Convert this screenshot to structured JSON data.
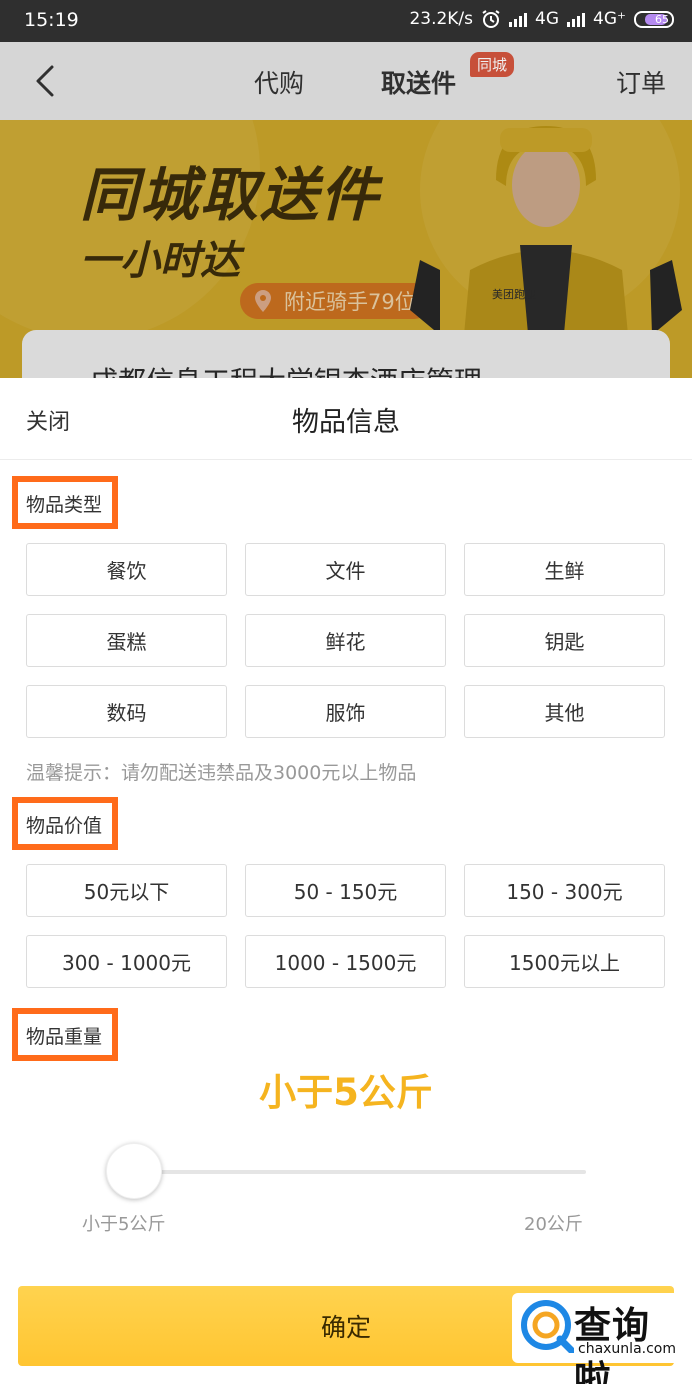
{
  "status_bar": {
    "time": "15:19",
    "speed": "23.2K/s",
    "net1": "4G",
    "net2": "4G⁺",
    "battery": "65"
  },
  "header": {
    "tabs": [
      "代购",
      "取送件",
      "订单"
    ],
    "badge": "同城",
    "active_tab": "取送件"
  },
  "banner": {
    "title": "同城取送件",
    "subtitle": "一小时达",
    "riders": "附近骑手79位",
    "jersey_text": "美团跑腿",
    "card_text": "成都信息工程大学银杏酒店管理"
  },
  "sheet": {
    "close": "关闭",
    "title": "物品信息",
    "type_label": "物品类型",
    "types": [
      "餐饮",
      "文件",
      "生鲜",
      "蛋糕",
      "鲜花",
      "钥匙",
      "数码",
      "服饰",
      "其他"
    ],
    "tip": "温馨提示：请勿配送违禁品及3000元以上物品",
    "value_label": "物品价值",
    "values": [
      "50元以下",
      "50 - 150元",
      "150 - 300元",
      "300 - 1000元",
      "1000 - 1500元",
      "1500元以上"
    ],
    "weight_label": "物品重量",
    "weight_value": "小于5公斤",
    "slider_level": 0,
    "range_min": "小于5公斤",
    "range_max": "20公斤",
    "confirm": "确定"
  },
  "watermark": {
    "cn": "查询啦",
    "en": "chaxunla.com"
  },
  "colors": {
    "accent": "#ffc531",
    "highlight": "#ff6b1a",
    "weight_text": "#f5b41f"
  }
}
